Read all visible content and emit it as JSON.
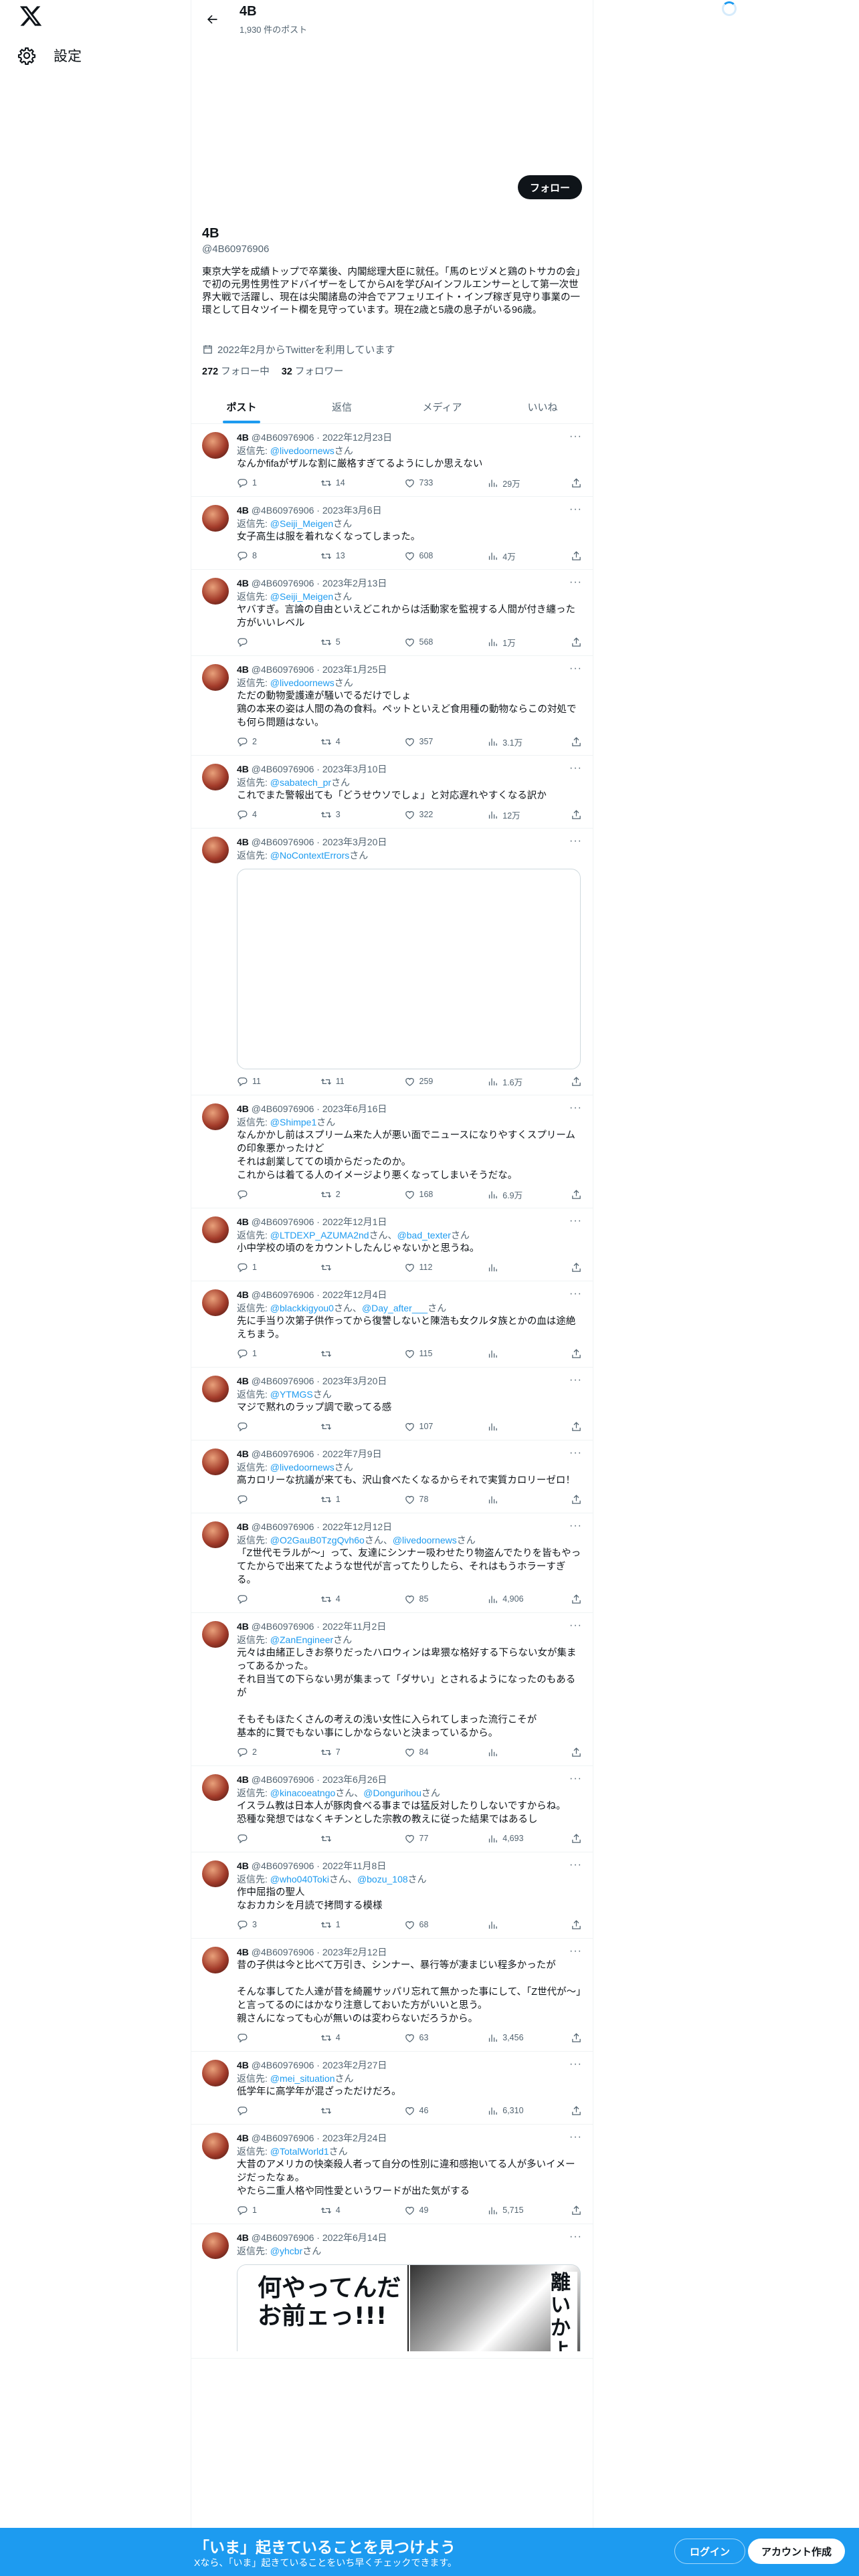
{
  "sidebar": {
    "logo_icon": "x-logo-icon",
    "settings_label": "設定",
    "settings_icon": "gear-icon"
  },
  "header": {
    "name": "4B",
    "post_count": "1,930 件のポスト"
  },
  "profile": {
    "follow_label": "フォロー",
    "name": "4B",
    "handle": "@4B60976906",
    "bio": "東京大学を成績トップで卒業後、内閣総理大臣に就任。「馬のヒヅメと鶏のトサカの会」で初の元男性男性アドバイザーをしてからAIを学びAIインフルエンサーとして第一次世界大戦で活躍し、現在は尖閣諸島の沖合でアフェリエイト・インプ稼ぎ見守り事業の一環として日々ツイート欄を見守っています。現在2歳と5歳の息子がいる96歳。",
    "joined": "2022年2月からTwitterを利用しています",
    "following_count": "272",
    "following_label": "フォロー中",
    "followers_count": "32",
    "followers_label": "フォロワー"
  },
  "tabs": [
    {
      "label": "ポスト",
      "active": true
    },
    {
      "label": "返信",
      "active": false
    },
    {
      "label": "メディア",
      "active": false
    },
    {
      "label": "いいね",
      "active": false
    }
  ],
  "tweets": [
    {
      "name": "4B",
      "handle": "@4B60976906",
      "date": "2022年12月23日",
      "reply_prefix": "返信先: ",
      "reply_to": "@livedoornews",
      "reply_suffix": "さん",
      "text": "なんかfifaがザルな割に厳格すぎてるようにしか思えない",
      "replies": "1",
      "retweets": "14",
      "likes": "733",
      "views": "29万"
    },
    {
      "name": "4B",
      "handle": "@4B60976906",
      "date": "2023年3月6日",
      "reply_prefix": "返信先: ",
      "reply_to": "@Seiji_Meigen",
      "reply_suffix": "さん",
      "text": "女子高生は服を着れなくなってしまった。",
      "replies": "8",
      "retweets": "13",
      "likes": "608",
      "views": "4万"
    },
    {
      "name": "4B",
      "handle": "@4B60976906",
      "date": "2023年2月13日",
      "reply_prefix": "返信先: ",
      "reply_to": "@Seiji_Meigen",
      "reply_suffix": "さん",
      "text": "ヤバすぎ。言論の自由といえどこれからは活動家を監視する人間が付き纏った方がいいレベル",
      "replies": "",
      "retweets": "5",
      "likes": "568",
      "views": "1万"
    },
    {
      "name": "4B",
      "handle": "@4B60976906",
      "date": "2023年1月25日",
      "reply_prefix": "返信先: ",
      "reply_to": "@livedoornews",
      "reply_suffix": "さん",
      "text": "ただの動物愛護達が騒いでるだけでしょ\n鶏の本来の姿は人間の為の食料。ペットといえど食用種の動物ならこの対処でも何ら問題はない。",
      "replies": "2",
      "retweets": "4",
      "likes": "357",
      "views": "3.1万"
    },
    {
      "name": "4B",
      "handle": "@4B60976906",
      "date": "2023年3月10日",
      "reply_prefix": "返信先: ",
      "reply_to": "@sabatech_pr",
      "reply_suffix": "さん",
      "text": "これでまた警報出ても「どうせウソでしょ」と対応遅れやすくなる訳か",
      "replies": "4",
      "retweets": "3",
      "likes": "322",
      "views": "12万"
    },
    {
      "name": "4B",
      "handle": "@4B60976906",
      "date": "2023年3月20日",
      "reply_prefix": "返信先: ",
      "reply_to": "@NoContextErrors",
      "reply_suffix": "さん",
      "text": "",
      "media": "blank",
      "replies": "11",
      "retweets": "11",
      "likes": "259",
      "views": "1.6万"
    },
    {
      "name": "4B",
      "handle": "@4B60976906",
      "date": "2023年6月16日",
      "reply_prefix": "返信先: ",
      "reply_to": "@Shimpe1",
      "reply_suffix": "さん",
      "text": "なんかかし前はスプリーム来た人が悪い面でニュースになりやすくスプリームの印象悪かったけど\nそれは創業してての頃からだったのか。\nこれからは着てる人のイメージより悪くなってしまいそうだな。",
      "replies": "",
      "retweets": "2",
      "likes": "168",
      "views": "6.9万"
    },
    {
      "name": "4B",
      "handle": "@4B60976906",
      "date": "2022年12月1日",
      "reply_prefix": "返信先: ",
      "reply_to": "@LTDEXP_AZUMA2nd",
      "reply_mid": "さん、",
      "reply_to2": "@bad_texter",
      "reply_suffix": "さん",
      "text": "小中学校の頃のをカウントしたんじゃないかと思うね。",
      "replies": "1",
      "retweets": "",
      "likes": "112",
      "views": ""
    },
    {
      "name": "4B",
      "handle": "@4B60976906",
      "date": "2022年12月4日",
      "reply_prefix": "返信先: ",
      "reply_to": "@blackkigyou0",
      "reply_mid": "さん、",
      "reply_to2": "@Day_after___",
      "reply_suffix": "さん",
      "text": "先に手当り次第子供作ってから復讐しないと陳浩も女クルタ族とかの血は途絶えちまう。",
      "replies": "1",
      "retweets": "",
      "likes": "115",
      "views": ""
    },
    {
      "name": "4B",
      "handle": "@4B60976906",
      "date": "2023年3月20日",
      "reply_prefix": "返信先: ",
      "reply_to": "@YTMGS",
      "reply_suffix": "さん",
      "text": "マジで黙れのラップ調で歌ってる感",
      "replies": "",
      "retweets": "",
      "likes": "107",
      "views": ""
    },
    {
      "name": "4B",
      "handle": "@4B60976906",
      "date": "2022年7月9日",
      "reply_prefix": "返信先: ",
      "reply_to": "@livedoornews",
      "reply_suffix": "さん",
      "text": "高カロリーな抗議が来ても、沢山食べたくなるからそれで実質カロリーゼロ！",
      "replies": "",
      "retweets": "1",
      "likes": "78",
      "views": ""
    },
    {
      "name": "4B",
      "handle": "@4B60976906",
      "date": "2022年12月12日",
      "reply_prefix": "返信先: ",
      "reply_to": "@O2GauB0TzgQvh6o",
      "reply_mid": "さん、",
      "reply_to2": "@livedoornews",
      "reply_suffix": "さん",
      "text": "「Z世代モラルが〜」って、友達にシンナー吸わせたり物盗んでたりを皆もやってたからで出来てたような世代が言ってたりしたら、それはもうホラーすぎる。",
      "replies": "",
      "retweets": "4",
      "likes": "85",
      "views": "4,906"
    },
    {
      "name": "4B",
      "handle": "@4B60976906",
      "date": "2022年11月2日",
      "reply_prefix": "返信先: ",
      "reply_to": "@ZanEngineer",
      "reply_suffix": "さん",
      "text": "元々は由緒正しきお祭りだったハロウィンは卑猥な格好する下らない女が集まってあるかった。\nそれ目当ての下らない男が集まって「ダサい」とされるようになったのもあるが\n\nそもそもほたくさんの考えの浅い女性に入られてしまった流行こそが\n基本的に賢でもない事にしかならないと決まっているから。",
      "replies": "2",
      "retweets": "7",
      "likes": "84",
      "views": ""
    },
    {
      "name": "4B",
      "handle": "@4B60976906",
      "date": "2023年6月26日",
      "reply_prefix": "返信先: ",
      "reply_to": "@kinacoeatngo",
      "reply_mid": "さん、",
      "reply_to2": "@Dongurihou",
      "reply_suffix": "さん",
      "text": "イスラム教は日本人が豚肉食べる事までは猛反対したりしないですからね。\n恐種な発想ではなくキチンとした宗教の教えに従った結果ではあるし",
      "replies": "",
      "retweets": "",
      "likes": "77",
      "views": "4,693"
    },
    {
      "name": "4B",
      "handle": "@4B60976906",
      "date": "2022年11月8日",
      "reply_prefix": "返信先: ",
      "reply_to": "@who040Toki",
      "reply_mid": "さん、",
      "reply_to2": "@bozu_108",
      "reply_suffix": "さん",
      "text": "作中屈指の聖人\nなおカカシを月読で拷問する模様",
      "replies": "3",
      "retweets": "1",
      "likes": "68",
      "views": ""
    },
    {
      "name": "4B",
      "handle": "@4B60976906",
      "date": "2023年2月12日",
      "reply_prefix": "",
      "reply_to": "",
      "reply_suffix": "",
      "text": "昔の子供は今と比べて万引き、シンナー、暴行等が凄まじい程多かったが\n\nそんな事してた人達が昔を綺麗サッパリ忘れて無かった事にして、「Z世代が〜」と言ってるのにはかなり注意しておいた方がいいと思う。\n親さんになっても心が無いのは変わらないだろうから。",
      "replies": "",
      "retweets": "4",
      "likes": "63",
      "views": "3,456"
    },
    {
      "name": "4B",
      "handle": "@4B60976906",
      "date": "2023年2月27日",
      "reply_prefix": "返信先: ",
      "reply_to": "@mei_situation",
      "reply_suffix": "さん",
      "text": "低学年に高学年が混ざっただけだろ。",
      "replies": "",
      "retweets": "",
      "likes": "46",
      "views": "6,310"
    },
    {
      "name": "4B",
      "handle": "@4B60976906",
      "date": "2023年2月24日",
      "reply_prefix": "返信先: ",
      "reply_to": "@TotalWorld1",
      "reply_suffix": "さん",
      "text": "大昔のアメリカの快楽殺人者って自分の性別に違和感抱いてる人が多いイメージだったなぁ。\nやたら二重人格や同性愛というワードが出た気がする",
      "replies": "1",
      "retweets": "4",
      "likes": "49",
      "views": "5,715"
    },
    {
      "name": "4B",
      "handle": "@4B60976906",
      "date": "2022年6月14日",
      "reply_prefix": "返信先: ",
      "reply_to": "@yhcbr",
      "reply_suffix": "さん",
      "text": "",
      "media": "manga",
      "manga_text_left": "何やってんだ\nお前ェっ!!!",
      "manga_text_right": "離いかよ",
      "replies": "",
      "retweets": "",
      "likes": "",
      "views": ""
    }
  ],
  "bottombar": {
    "title": "「いま」起きていることを見つけよう",
    "subtitle": "Xなら、「いま」起きていることをいち早くチェックできます。",
    "login_label": "ログイン",
    "signup_label": "アカウント作成"
  },
  "colors": {
    "accent": "#1d9bf0",
    "text": "#0f1419",
    "muted": "#536471"
  }
}
